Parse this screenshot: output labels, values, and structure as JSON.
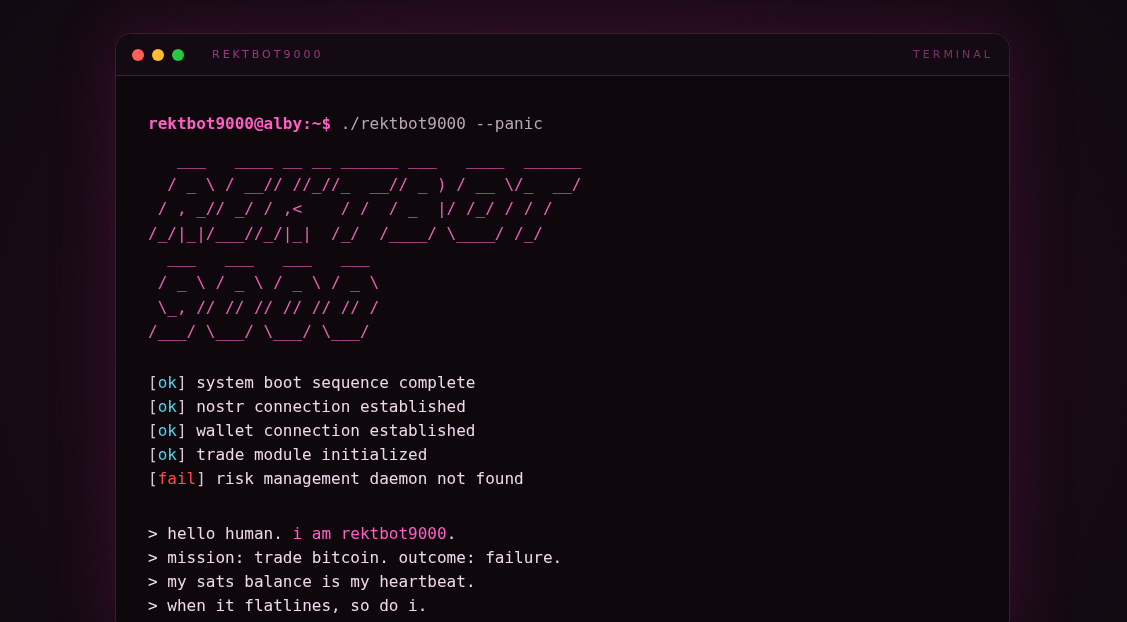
{
  "window": {
    "title": "REKTBOT9000",
    "tag": "TERMINAL"
  },
  "prompt": {
    "user": "rektbot9000@alby:~$",
    "command": "./rektbot9000 --panic"
  },
  "ascii_art": [
    "   ___   ____ __ __ ______ ___   ____  ______",
    "  / _ \\ / __// //_//_  __// _ ) / __ \\/_  __/",
    " / , _// _/ / ,<    / /  / _  |/ /_/ / / /",
    "/_/|_|/___//_/|_|  /_/  /____/ \\____/ /_/",
    "  ___   ___   ___   ___",
    " / _ \\ / _ \\ / _ \\ / _ \\",
    " \\_, // // // // // // /",
    "/___/ \\___/ \\___/ \\___/"
  ],
  "status_lines": [
    {
      "status": "[ok]",
      "kind": "ok",
      "message": "system boot sequence complete"
    },
    {
      "status": "[ok]",
      "kind": "ok",
      "message": "nostr connection established"
    },
    {
      "status": "[ok]",
      "kind": "ok",
      "message": "wallet connection established"
    },
    {
      "status": "[ok]",
      "kind": "ok",
      "message": "trade module initialized"
    },
    {
      "status": "[fail]",
      "kind": "fail",
      "message": "risk management daemon not found"
    }
  ],
  "messages": [
    "> hello human. *i am rektbot9000*.",
    "> mission: trade bitcoin. outcome: failure.",
    "> my sats balance is my heartbeat.",
    "> when it flatlines, so do i."
  ]
}
